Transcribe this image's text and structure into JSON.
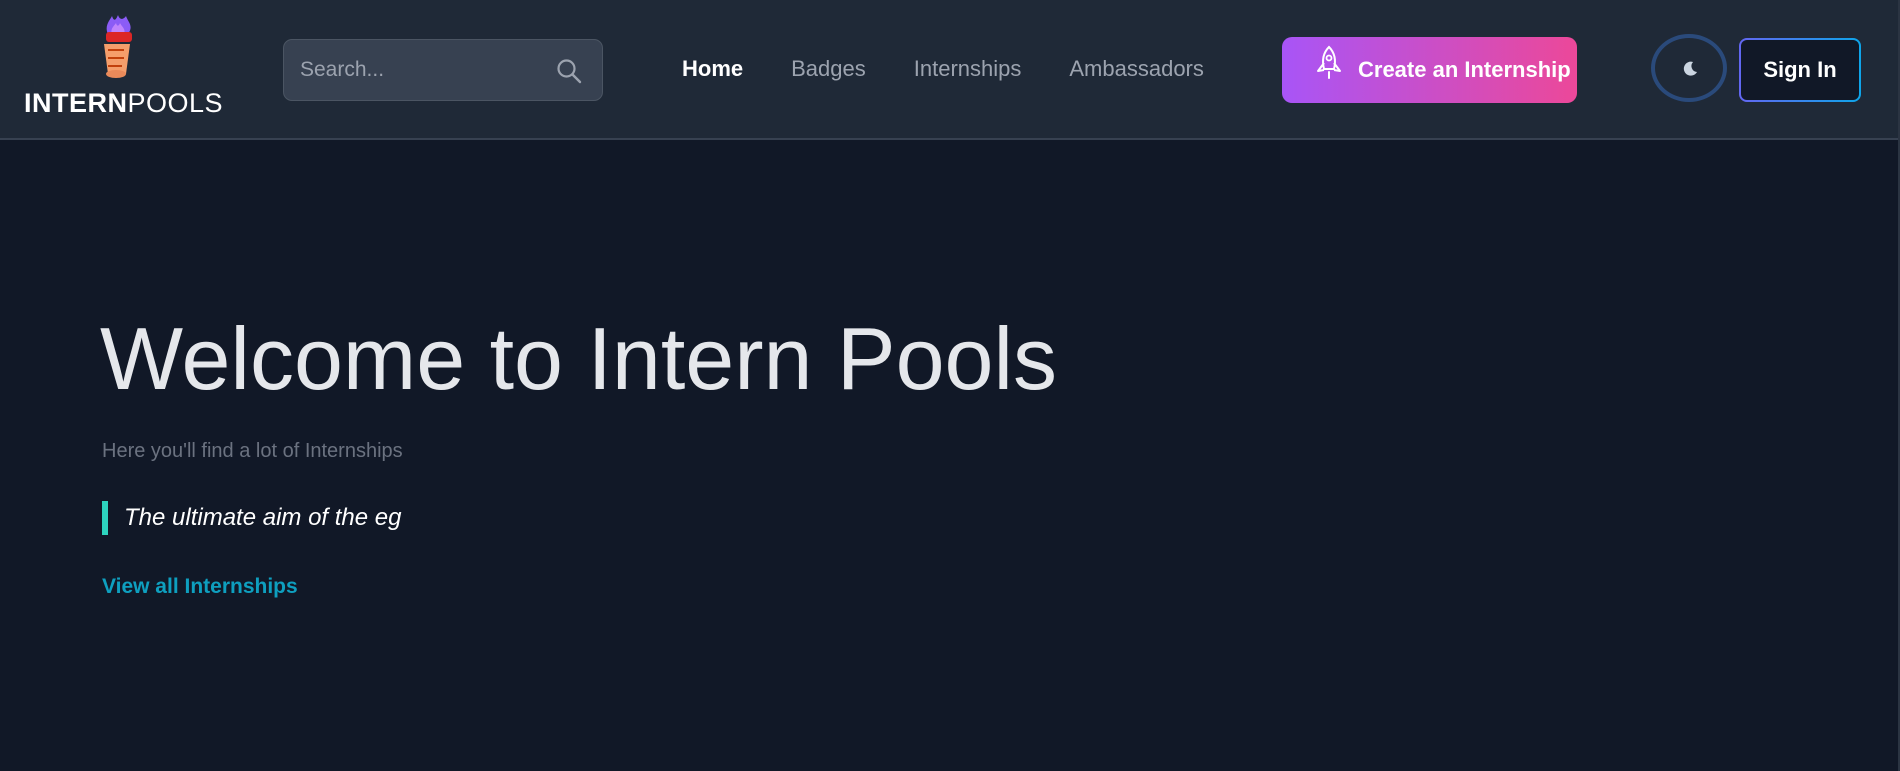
{
  "brand": {
    "name_bold": "INTERN",
    "name_light": "POOLS"
  },
  "search": {
    "placeholder": "Search..."
  },
  "nav": {
    "items": [
      {
        "label": "Home",
        "active": true
      },
      {
        "label": "Badges",
        "active": false
      },
      {
        "label": "Internships",
        "active": false
      },
      {
        "label": "Ambassadors",
        "active": false
      }
    ]
  },
  "actions": {
    "create_label": "Create an Internship",
    "signin_label": "Sign In",
    "theme_icon": "moon-icon"
  },
  "hero": {
    "title": "Welcome to Intern Pools",
    "subtitle": "Here you'll find a lot of Internships",
    "quote": "The ultimate aim of the eg",
    "link_label": "View all Internships"
  },
  "colors": {
    "background": "#111827",
    "header": "#1f2937",
    "gradient_start": "#a855f7",
    "gradient_end": "#ec4899",
    "quote_accent": "#2dd4bf",
    "link": "#0e9fbf"
  }
}
